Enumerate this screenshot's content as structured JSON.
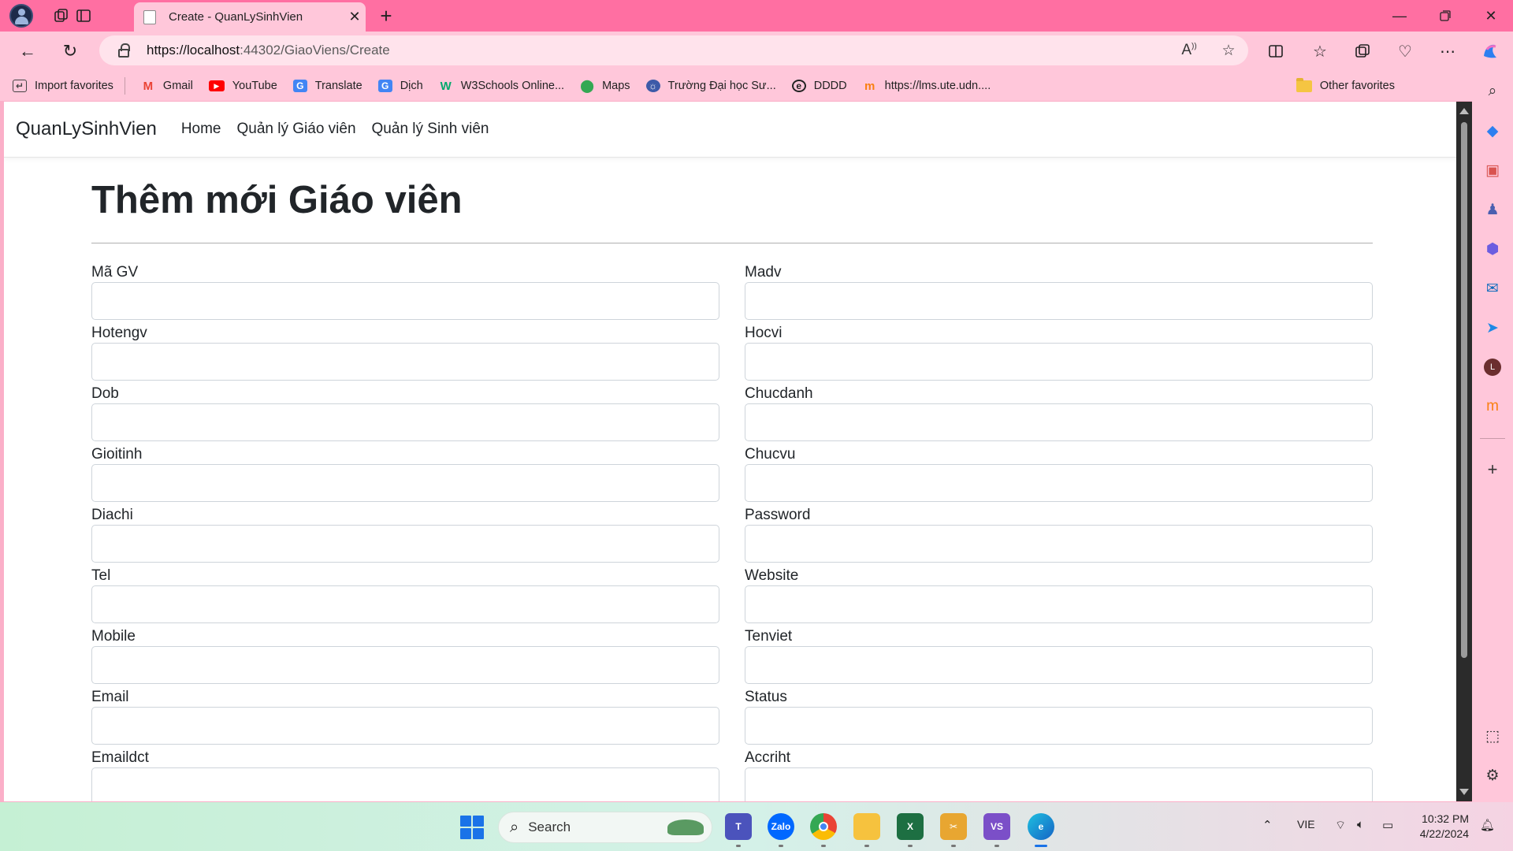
{
  "browser": {
    "tab_title": "Create - QuanLySinhVien",
    "url_host": "https://localhost",
    "url_path": ":44302/GiaoViens/Create",
    "favorites": [
      {
        "label": "Import favorites",
        "icon": "import-icon",
        "color": "#444444"
      },
      {
        "label": "Gmail",
        "icon": "gmail-icon",
        "color": "#ea4335"
      },
      {
        "label": "YouTube",
        "icon": "youtube-icon",
        "color": "#ff0000"
      },
      {
        "label": "Translate",
        "icon": "translate-icon",
        "color": "#4285f4"
      },
      {
        "label": "Dịch",
        "icon": "translate-icon",
        "color": "#4285f4"
      },
      {
        "label": "W3Schools Online...",
        "icon": "w3schools-icon",
        "color": "#04aa6d"
      },
      {
        "label": "Maps",
        "icon": "maps-icon",
        "color": "#34a853"
      },
      {
        "label": "Trường Đại học Sư...",
        "icon": "university-icon",
        "color": "#3d5aa8"
      },
      {
        "label": "DDDD",
        "icon": "edge-icon",
        "color": "#222222"
      },
      {
        "label": "https://lms.ute.udn....",
        "icon": "moodle-icon",
        "color": "#f98012"
      }
    ],
    "other_favorites": "Other favorites"
  },
  "site": {
    "brand": "QuanLySinhVien",
    "nav": [
      "Home",
      "Quản lý Giáo viên",
      "Quản lý Sinh viên"
    ]
  },
  "page": {
    "title": "Thêm mới Giáo viên",
    "left_fields": [
      "Mã GV",
      "Hotengv",
      "Dob",
      "Gioitinh",
      "Diachi",
      "Tel",
      "Mobile",
      "Email",
      "Emaildct"
    ],
    "right_fields": [
      "Madv",
      "Hocvi",
      "Chucdanh",
      "Chucvu",
      "Password",
      "Website",
      "Tenviet",
      "Status",
      "Accriht"
    ]
  },
  "taskbar": {
    "search_label": "Search",
    "language": "VIE",
    "time": "10:32 PM",
    "date": "4/22/2024"
  },
  "colors": {
    "titlebar": "#ff6fa2",
    "toolbar": "#ffc7da",
    "accent": "#1a73e8"
  }
}
